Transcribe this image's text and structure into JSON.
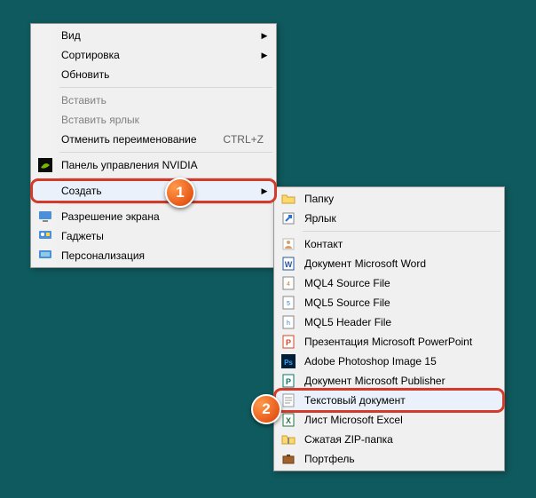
{
  "menu1": {
    "view": "Вид",
    "sort": "Сортировка",
    "refresh": "Обновить",
    "paste": "Вставить",
    "paste_shortcut": "Вставить ярлык",
    "undo_rename": "Отменить переименование",
    "undo_key": "CTRL+Z",
    "nvidia": "Панель управления NVIDIA",
    "create": "Создать",
    "resolution": "Разрешение экрана",
    "gadgets": "Гаджеты",
    "personalization": "Персонализация"
  },
  "menu2": {
    "folder": "Папку",
    "shortcut": "Ярлык",
    "contact": "Контакт",
    "word": "Документ Microsoft Word",
    "mql4": "MQL4 Source File",
    "mql5": "MQL5 Source File",
    "mql5h": "MQL5 Header File",
    "ppt": "Презентация Microsoft PowerPoint",
    "psd": "Adobe Photoshop Image 15",
    "pub": "Документ Microsoft Publisher",
    "txt": "Текстовый документ",
    "xls": "Лист Microsoft Excel",
    "zip": "Сжатая ZIP-папка",
    "briefcase": "Портфель"
  },
  "callouts": {
    "one": "1",
    "two": "2"
  }
}
